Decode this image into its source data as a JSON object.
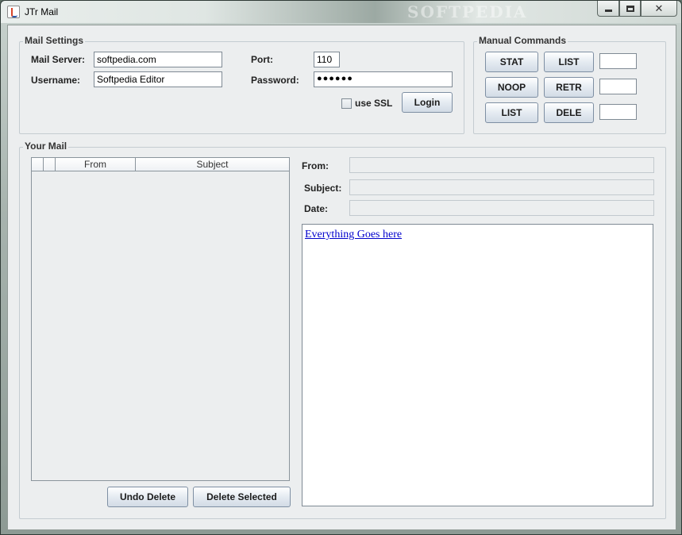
{
  "window": {
    "title": "JTr Mail",
    "watermark": "SOFTPEDIA"
  },
  "mail_settings": {
    "title": "Mail Settings",
    "mail_server_label": "Mail Server:",
    "mail_server_value": "softpedia.com",
    "port_label": "Port:",
    "port_value": "110",
    "username_label": "Username:",
    "username_value": "Softpedia Editor",
    "password_label": "Password:",
    "password_value": "●●●●●●",
    "use_ssl_label": "use SSL",
    "use_ssl_checked": false,
    "login_label": "Login"
  },
  "manual_commands": {
    "title": "Manual Commands",
    "buttons": [
      "STAT",
      "LIST",
      "NOOP",
      "RETR",
      "LIST",
      "DELE"
    ]
  },
  "your_mail": {
    "title": "Your Mail",
    "columns": [
      "",
      "",
      "From",
      "Subject"
    ],
    "from_label": "From:",
    "subject_label": "Subject:",
    "date_label": "Date:",
    "message_link": "Everything Goes here",
    "undo_delete_label": "Undo Delete",
    "delete_selected_label": "Delete Selected"
  },
  "icons": {
    "app": "java-cup-icon",
    "minimize": "minimize-icon",
    "maximize": "maximize-icon",
    "close": "close-icon"
  }
}
